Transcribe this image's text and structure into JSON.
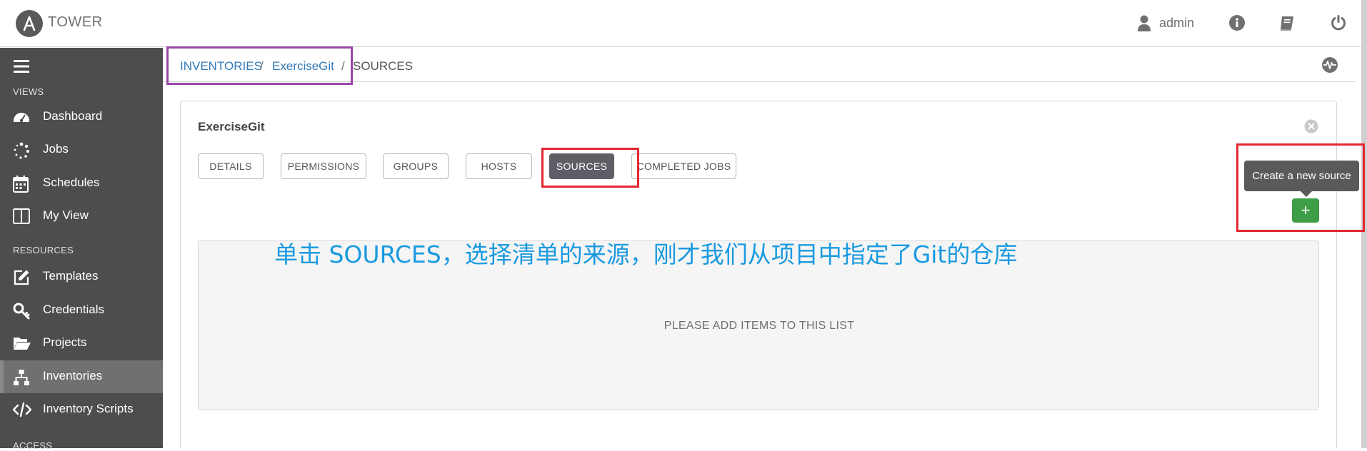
{
  "header": {
    "brand": "TOWER",
    "user": "admin"
  },
  "sidebar": {
    "sections": {
      "views": "VIEWS",
      "resources": "RESOURCES",
      "access": "ACCESS"
    },
    "items": [
      {
        "label": "Dashboard",
        "icon": "dashboard-icon"
      },
      {
        "label": "Jobs",
        "icon": "spinner-icon"
      },
      {
        "label": "Schedules",
        "icon": "calendar-icon"
      },
      {
        "label": "My View",
        "icon": "columns-icon"
      },
      {
        "label": "Templates",
        "icon": "edit-icon"
      },
      {
        "label": "Credentials",
        "icon": "key-icon"
      },
      {
        "label": "Projects",
        "icon": "folder-open-icon"
      },
      {
        "label": "Inventories",
        "icon": "sitemap-icon",
        "active": true
      },
      {
        "label": "Inventory Scripts",
        "icon": "code-icon"
      }
    ]
  },
  "breadcrumb": {
    "items": [
      "INVENTORIES",
      "ExerciseGit",
      "SOURCES"
    ],
    "separator": "/"
  },
  "panel": {
    "title": "ExerciseGit",
    "tabs": [
      "DETAILS",
      "PERMISSIONS",
      "GROUPS",
      "HOSTS",
      "SOURCES",
      "COMPLETED JOBS"
    ],
    "active_tab": "SOURCES",
    "tooltip": "Create a new source",
    "add_label": "+",
    "empty_message": "PLEASE ADD ITEMS TO THIS LIST"
  },
  "annotation": "单击 SOURCES，选择清单的来源，刚才我们从项目中指定了Git的仓库",
  "colors": {
    "sidebar_bg": "#4d4d4d",
    "active_tab": "#5e5e66",
    "add_button": "#3e9e48",
    "link": "#337ab7",
    "highlight_red": "#e3262f",
    "highlight_purple": "#9a47a8",
    "annotation": "#1a9ae0"
  }
}
